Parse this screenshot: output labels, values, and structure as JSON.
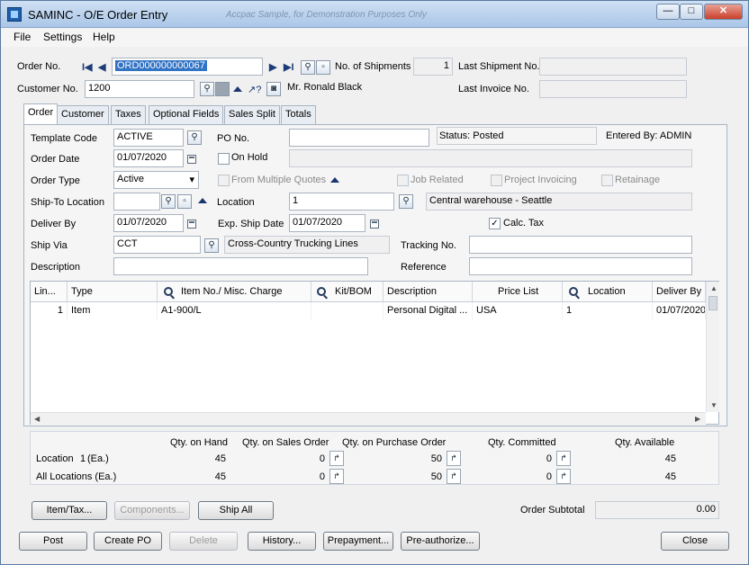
{
  "window": {
    "title": "SAMINC - O/E Order Entry",
    "title_faint": "Accpac Sample, for Demonstration Purposes Only",
    "caption_min": "—",
    "caption_max": "□",
    "caption_close": "✕"
  },
  "menu": [
    "File",
    "Settings",
    "Help"
  ],
  "header": {
    "order_no_label": "Order No.",
    "order_no_value": "ORD000000000067",
    "nav_first": "I◀",
    "nav_prev": "◀",
    "nav_next": "▶",
    "nav_last": "▶I",
    "no_of_shipments_label": "No. of Shipments",
    "no_of_shipments_value": "1",
    "last_shipment_label": "Last Shipment No.",
    "last_shipment_value": "",
    "customer_no_label": "Customer No.",
    "customer_no_value": "1200",
    "customer_name": "Mr. Ronald Black",
    "last_invoice_label": "Last Invoice No.",
    "last_invoice_value": "",
    "order_subtotal_label": "Order Subtotal",
    "order_subtotal_value": "0.00"
  },
  "tabs": [
    {
      "label": "Order",
      "active": true
    },
    {
      "label": "Customer",
      "active": false
    },
    {
      "label": "Taxes",
      "active": false
    },
    {
      "label": "Optional Fields",
      "active": false
    },
    {
      "label": "Sales Split",
      "active": false
    },
    {
      "label": "Totals",
      "active": false
    }
  ],
  "order_tab": {
    "template_code_label": "Template Code",
    "template_code_value": "ACTIVE",
    "po_no_label": "PO No.",
    "po_no_value": "",
    "status_text": "Status: Posted",
    "entered_by_text": "Entered By: ADMIN",
    "order_date_label": "Order Date",
    "order_date_value": "01/07/2020",
    "on_hold_label": "On Hold",
    "order_type_label": "Order Type",
    "order_type_value": "Active",
    "from_multiple_quotes_label": "From Multiple Quotes",
    "job_related_label": "Job Related",
    "project_invoicing_label": "Project Invoicing",
    "retainage_label": "Retainage",
    "ship_to_location_label": "Ship-To Location",
    "ship_to_location_value": "",
    "location_label": "Location",
    "location_value": "1",
    "location_desc": "Central warehouse - Seattle",
    "deliver_by_label": "Deliver By",
    "deliver_by_value": "01/07/2020",
    "exp_ship_date_label": "Exp. Ship Date",
    "exp_ship_date_value": "01/07/2020",
    "calc_tax_label": "Calc. Tax",
    "calc_tax_checked": "✓",
    "ship_via_label": "Ship Via",
    "ship_via_value": "CCT",
    "ship_via_desc": "Cross-Country Trucking Lines",
    "tracking_no_label": "Tracking No.",
    "tracking_no_value": "",
    "description_label": "Description",
    "description_value": "",
    "reference_label": "Reference",
    "reference_value": ""
  },
  "grid": {
    "columns": [
      "Lin...",
      "Type",
      "Item No./ Misc. Charge",
      "Kit/BOM",
      "Description",
      "Price List",
      "Location",
      "Deliver By"
    ],
    "rows": [
      {
        "line": "1",
        "type": "Item",
        "item_no": "A1-900/L",
        "kit": "",
        "description": "Personal Digital ...",
        "price_list": "USA",
        "location": "1",
        "deliver_by": "01/07/2020"
      }
    ]
  },
  "quantities": {
    "headers": [
      "Qty. on Hand",
      "Qty. on Sales Order",
      "Qty. on Purchase Order",
      "Qty. Committed",
      "Qty. Available"
    ],
    "location_label": "Location",
    "location_value": "1",
    "location_unit": "(Ea.)",
    "all_locations_label": "All Locations (Ea.)",
    "location_row": [
      "45",
      "0",
      "50",
      "0",
      "45"
    ],
    "all_row": [
      "45",
      "0",
      "50",
      "0",
      "45"
    ]
  },
  "buttons": {
    "item_tax": "Item/Tax...",
    "components": "Components...",
    "ship_all": "Ship All",
    "post": "Post",
    "create_po": "Create PO",
    "delete": "Delete",
    "history": "History...",
    "prepayment": "Prepayment...",
    "preauthorize": "Pre-authorize...",
    "close": "Close"
  }
}
